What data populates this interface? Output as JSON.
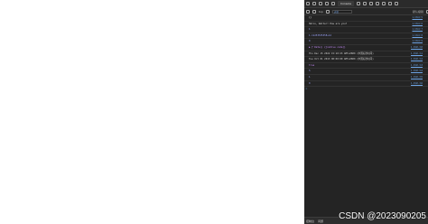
{
  "devtools": {
    "tabs": {
      "active": "Console"
    },
    "toolbar": {
      "context": "top",
      "filter_placeholder": "过滤",
      "levels": "默认级别"
    },
    "console": {
      "messages": [
        {
          "text": "{}",
          "source": "1.html:5",
          "kind": "plain"
        },
        {
          "text": "Hello, Walter! How are you?",
          "source": "1.html:6",
          "kind": "plain"
        },
        {
          "text": "1",
          "source": "1.html:7",
          "kind": "num"
        },
        {
          "text": "1.1125353535E+12",
          "source": "1.html:8",
          "kind": "num"
        },
        {
          "text": "0",
          "source": "1.html:9",
          "kind": "num"
        },
        {
          "text": "▶ ƒ Date() {[native code]}",
          "source": "1.html:10",
          "kind": "obj"
        },
        {
          "text": "Thu Dec 15 2022 15:10:23 GMT+0800 (中国标准时间)",
          "source": "1.html:11",
          "kind": "plain"
        },
        {
          "text": "Tue Oct 01 2013 00:00:00 GMT+0800 (中国标准时间)",
          "source": "1.html:12",
          "kind": "plain"
        },
        {
          "text": "true",
          "source": "1.html:13",
          "kind": "obj"
        },
        {
          "text": "5",
          "source": "1.html:14",
          "kind": "num"
        },
        {
          "text": "1",
          "source": "1.html:15",
          "kind": "num"
        },
        {
          "text": "0",
          "source": "1.html:16",
          "kind": "num"
        }
      ],
      "prompt": ">"
    },
    "drawer": {
      "tabs": [
        "控制台",
        "问题"
      ]
    }
  },
  "watermark": "CSDN @2023090205"
}
